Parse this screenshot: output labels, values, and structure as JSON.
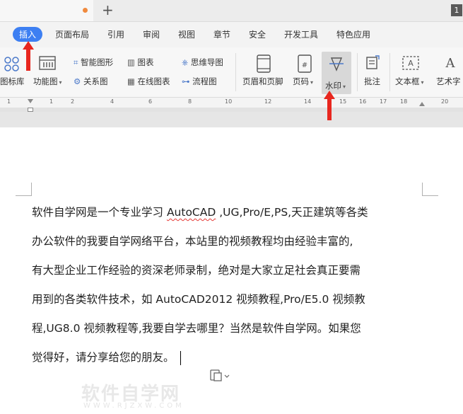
{
  "tabbar": {
    "window_badge": "1"
  },
  "menu": {
    "items": [
      "插入",
      "页面布局",
      "引用",
      "审阅",
      "视图",
      "章节",
      "安全",
      "开发工具",
      "特色应用"
    ],
    "active_index": 0
  },
  "ribbon": {
    "icon_library": "图标库",
    "feature_chart": "功能图",
    "smart_shape": "智能图形",
    "chart": "图表",
    "mind_map": "思维导图",
    "relation_chart": "关系图",
    "online_chart": "在线图表",
    "flowchart": "流程图",
    "header_footer": "页眉和页脚",
    "page_number": "页码",
    "watermark": "水印",
    "comment": "批注",
    "text_box": "文本框",
    "word_art": "艺术字"
  },
  "ruler": {
    "numbers": [
      "1",
      "1",
      "2",
      "4",
      "6",
      "8",
      "10",
      "12",
      "14",
      "15",
      "16",
      "17",
      "18",
      "20"
    ]
  },
  "document": {
    "lines": [
      [
        "软件自学网是一个专业学习 ",
        "AutoCAD",
        " ,UG,Pro/E,PS,天正建筑等各类"
      ],
      [
        "办公软件的我要自学网络平台，本站里的视频教程均由经验丰富的,"
      ],
      [
        "有大型企业工作经验的资深老师录制，绝对是大家立足社会真正要需"
      ],
      [
        "用到的各类软件技术，如 AutoCAD2012 视频教程,Pro/E5.0 视频教"
      ],
      [
        "程,UG8.0 视频教程等,我要自学去哪里？当然是软件自学网。如果您"
      ],
      [
        "觉得好，请分享给您的朋友。"
      ]
    ]
  },
  "watermark_overlay": {
    "text": "软件自学网",
    "url": "WWW.RJZXW.COM"
  },
  "colors": {
    "accent": "#3d7ff2",
    "arrow": "#e8271f",
    "tab_dot": "#f08a3e"
  }
}
